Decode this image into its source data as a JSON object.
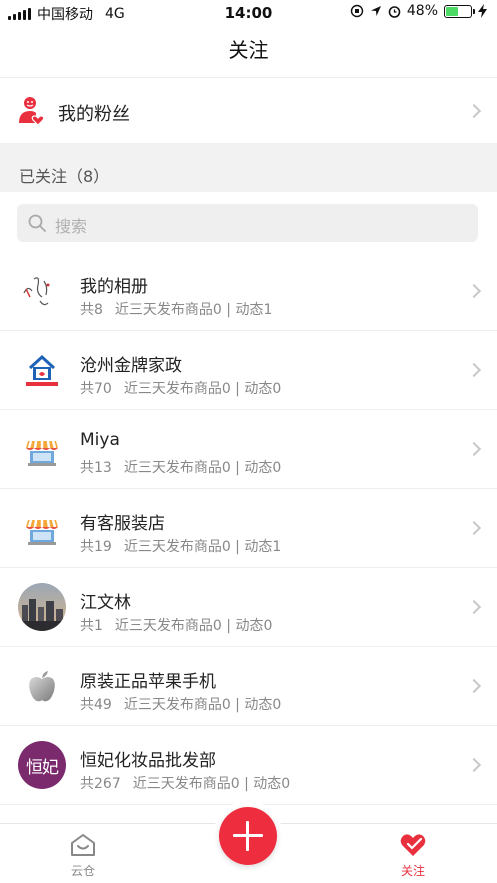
{
  "status_bar": {
    "carrier": "中国移动",
    "network": "4G",
    "time": "14:00",
    "battery_percent": "48%",
    "battery_level": 0.48
  },
  "nav": {
    "title": "关注"
  },
  "fans": {
    "label": "我的粉丝"
  },
  "following": {
    "title": "已关注（8）"
  },
  "search": {
    "placeholder": "搜索"
  },
  "items": [
    {
      "name": "我的相册",
      "count": "共8",
      "stats": "近三天发布商品0 | 动态1",
      "avatar": "sketch-figure-icon"
    },
    {
      "name": "沧州金牌家政",
      "count": "共70",
      "stats": "近三天发布商品0 | 动态0",
      "avatar": "house-logo-icon"
    },
    {
      "name": "Miya",
      "count": "共13",
      "stats": "近三天发布商品0 | 动态0",
      "avatar": "store-icon"
    },
    {
      "name": "有客服装店",
      "count": "共19",
      "stats": "近三天发布商品0 | 动态1",
      "avatar": "store-icon"
    },
    {
      "name": "江文林",
      "count": "共1",
      "stats": "近三天发布商品0 | 动态0",
      "avatar": "city-photo"
    },
    {
      "name": "原装正品苹果手机",
      "count": "共49",
      "stats": "近三天发布商品0 | 动态0",
      "avatar": "apple-logo-icon"
    },
    {
      "name": "恒妃化妆品批发部",
      "count": "共267",
      "stats": "近三天发布商品0 | 动态0",
      "avatar": "hengfei-logo",
      "avatar_text": "恒妃"
    }
  ],
  "tabs": {
    "left": "云仓",
    "right": "关注"
  },
  "colors": {
    "accent": "#e8303f",
    "fab": "#ee2d3f"
  }
}
